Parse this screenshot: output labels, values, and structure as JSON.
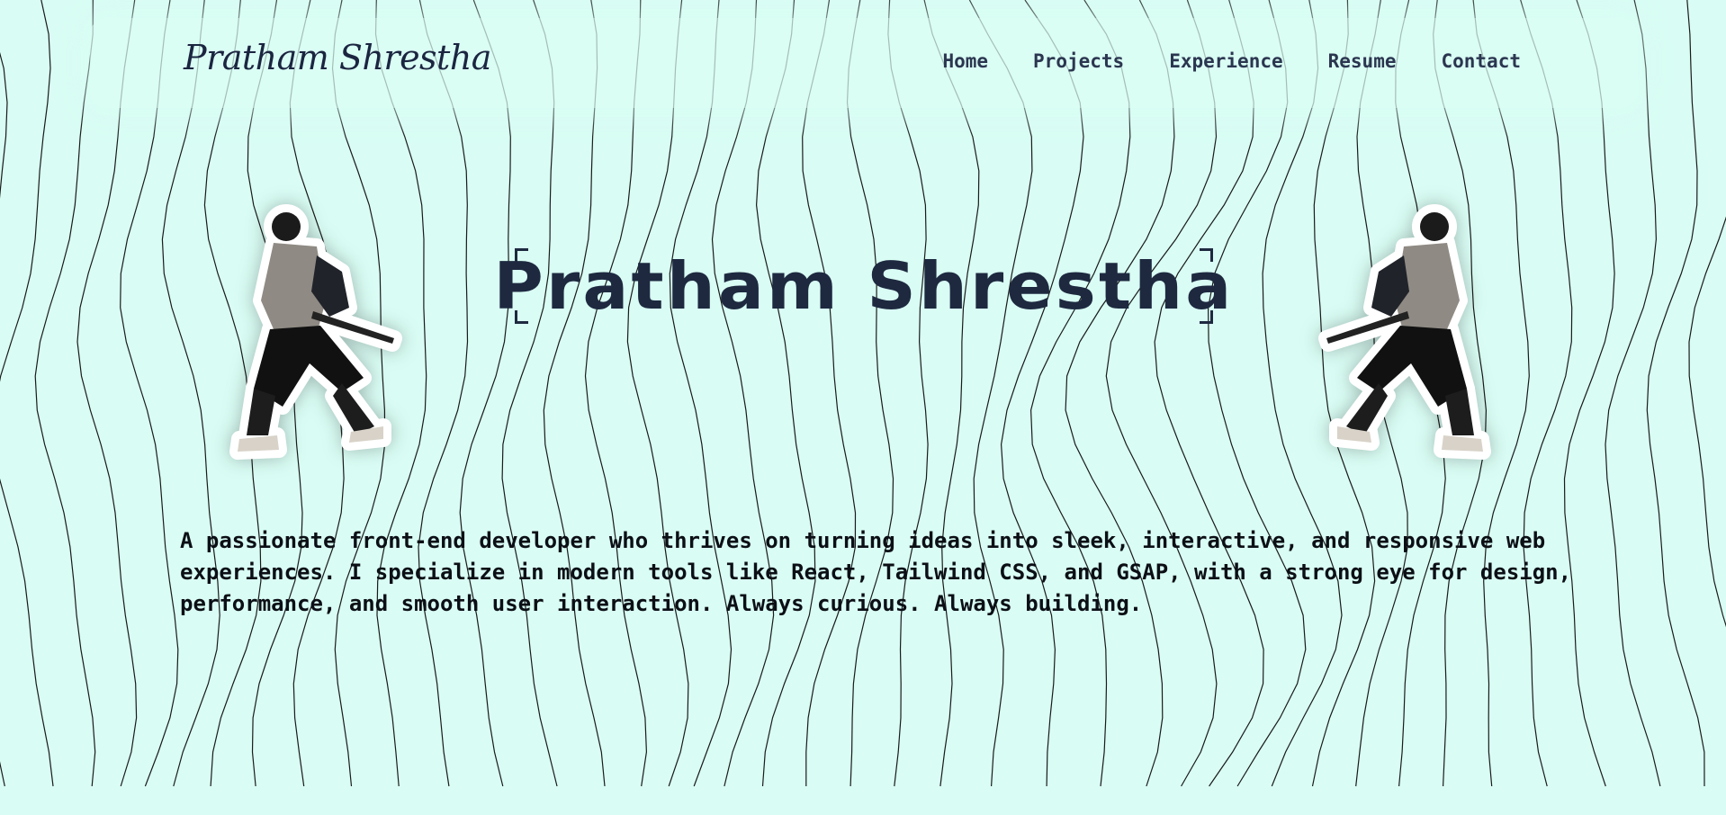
{
  "brand": {
    "name": "Pratham Shrestha"
  },
  "nav": {
    "items": [
      {
        "label": "Home"
      },
      {
        "label": "Projects"
      },
      {
        "label": "Experience"
      },
      {
        "label": "Resume"
      },
      {
        "label": "Contact"
      }
    ]
  },
  "hero": {
    "title": "Pratham Shrestha",
    "bio": "A passionate front-end developer who thrives on turning ideas into sleek, interactive, and responsive web experiences. I specialize in modern tools like React, Tailwind CSS, and GSAP, with a strong eye for design, performance, and smooth user interaction. Always curious. Always building."
  },
  "colors": {
    "background": "#d9fdf4",
    "text": "#1e2940",
    "line": "#1a1a1a"
  },
  "icons": {
    "left_figure": "person-with-sword-icon",
    "right_figure": "person-with-sword-icon"
  }
}
